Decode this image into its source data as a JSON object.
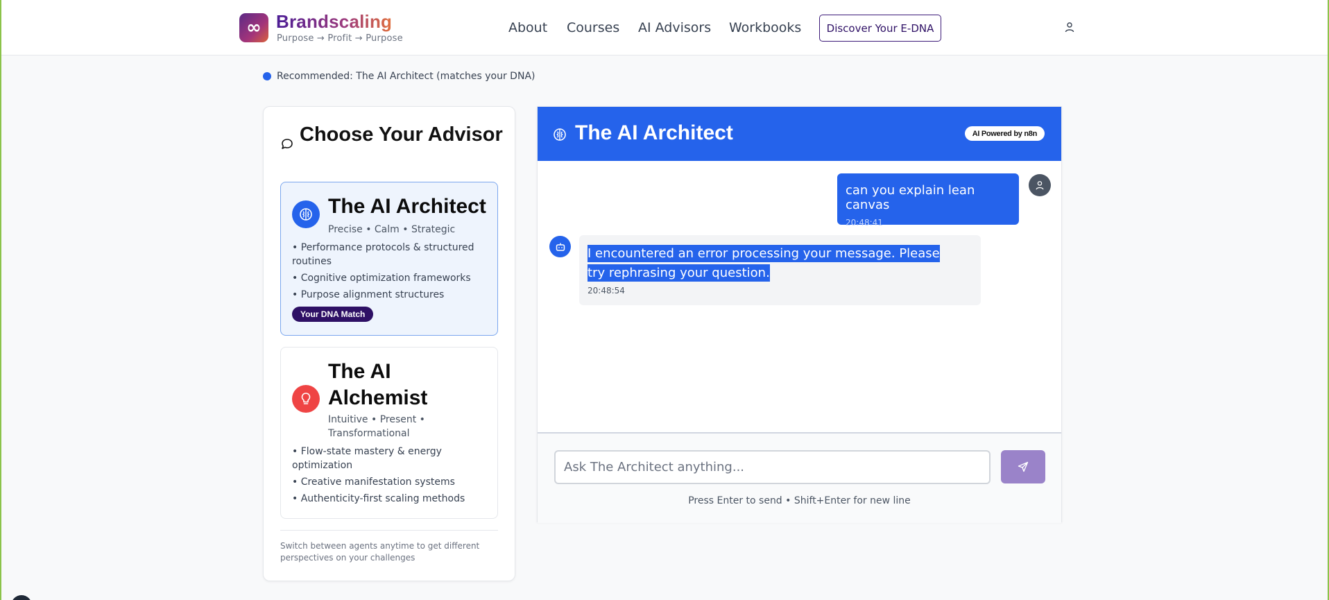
{
  "header": {
    "brand_name": "Brandscaling",
    "brand_tagline": "Purpose → Profit → Purpose",
    "logo_glyph": "∞",
    "nav": {
      "about": "About",
      "courses": "Courses",
      "ai_advisors": "AI Advisors",
      "workbooks": "Workbooks"
    },
    "cta_label": "Discover Your E-DNA"
  },
  "recommendation": "Recommended: The AI Architect (matches your DNA)",
  "advisor_panel": {
    "title": "Choose Your Advisor",
    "advisors": [
      {
        "name": "The AI Architect",
        "traits": "Precise • Calm • Strategic",
        "points": [
          "• Performance protocols & structured routines",
          "• Cognitive optimization frameworks",
          "• Purpose alignment structures"
        ],
        "badge": "Your DNA Match",
        "color": "#2563eb",
        "icon": "brain-icon"
      },
      {
        "name": "The AI Alchemist",
        "traits": "Intuitive • Present • Transformational",
        "points": [
          "• Flow-state mastery & energy optimization",
          "• Creative manifestation systems",
          "• Authenticity-first scaling methods"
        ],
        "color": "#ef4444",
        "icon": "lightbulb-icon"
      }
    ],
    "footer": "Switch between agents anytime to get different perspectives on your challenges"
  },
  "chat": {
    "title": "The AI Architect",
    "powered_by": "AI Powered by n8n",
    "messages": [
      {
        "role": "user",
        "text": "can you explain lean canvas",
        "time": "20:48:41"
      },
      {
        "role": "bot",
        "text": "I encountered an error processing your message. Please try rephrasing your question.",
        "time": "20:48:54"
      }
    ],
    "input_placeholder": "Ask The Architect anything...",
    "hint": "Press Enter to send • Shift+Enter for new line"
  },
  "colors": {
    "accent": "#2563eb",
    "brand_purple": "#2e1065",
    "send_button": "#9a83c9"
  }
}
